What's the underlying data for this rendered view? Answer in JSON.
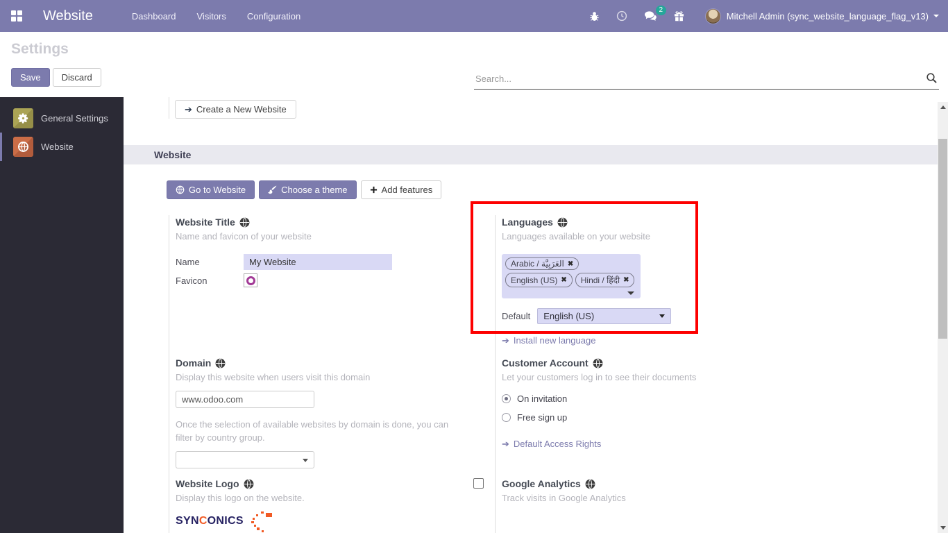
{
  "navbar": {
    "brand": "Website",
    "menus": {
      "dashboard": "Dashboard",
      "visitors": "Visitors",
      "configuration": "Configuration"
    },
    "message_count": "2",
    "user": "Mitchell Admin (sync_website_language_flag_v13)"
  },
  "control_panel": {
    "title": "Settings",
    "save_label": "Save",
    "discard_label": "Discard",
    "search_placeholder": "Search..."
  },
  "sidebar": {
    "items": [
      {
        "label": "General Settings"
      },
      {
        "label": "Website"
      }
    ]
  },
  "content": {
    "create_website_label": "Create a New Website",
    "section_title": "Website",
    "buttons": {
      "go_to_website": "Go to Website",
      "choose_theme": "Choose a theme",
      "add_features": "Add features"
    },
    "website_title": {
      "heading": "Website Title",
      "subtitle": "Name and favicon of your website",
      "name_label": "Name",
      "name_value": "My Website",
      "favicon_label": "Favicon"
    },
    "languages": {
      "heading": "Languages",
      "subtitle": "Languages available on your website",
      "tags": [
        "Arabic / العَرَبِيَّة",
        "English (US)",
        "Hindi / हिंदी"
      ],
      "remove_glyph": "✖",
      "default_label": "Default",
      "default_value": "English (US)",
      "install_link": "Install new language"
    },
    "domain": {
      "heading": "Domain",
      "subtitle": "Display this website when users visit this domain",
      "value": "www.odoo.com",
      "note": "Once the selection of available websites by domain is done, you can filter by country group."
    },
    "customer_account": {
      "heading": "Customer Account",
      "subtitle": "Let your customers log in to see their documents",
      "options": [
        "On invitation",
        "Free sign up"
      ],
      "selected": "On invitation",
      "link": "Default Access Rights"
    },
    "website_logo": {
      "heading": "Website Logo",
      "subtitle": "Display this logo on the website.",
      "logo_before": "SYN",
      "logo_accent": "C",
      "logo_after": "ONICS"
    },
    "google_analytics": {
      "heading": "Google Analytics",
      "subtitle": "Track visits in Google Analytics"
    }
  },
  "glyphs": {
    "arrow": "➔"
  },
  "colors": {
    "accent": "#7c7bad",
    "highlight_frame": "#fd0000",
    "field_bg": "#d9d9f5",
    "badge": "#26a69a",
    "logo_navy": "#262262",
    "logo_orange": "#f15a24",
    "favicon_ring": "#a23a96"
  }
}
